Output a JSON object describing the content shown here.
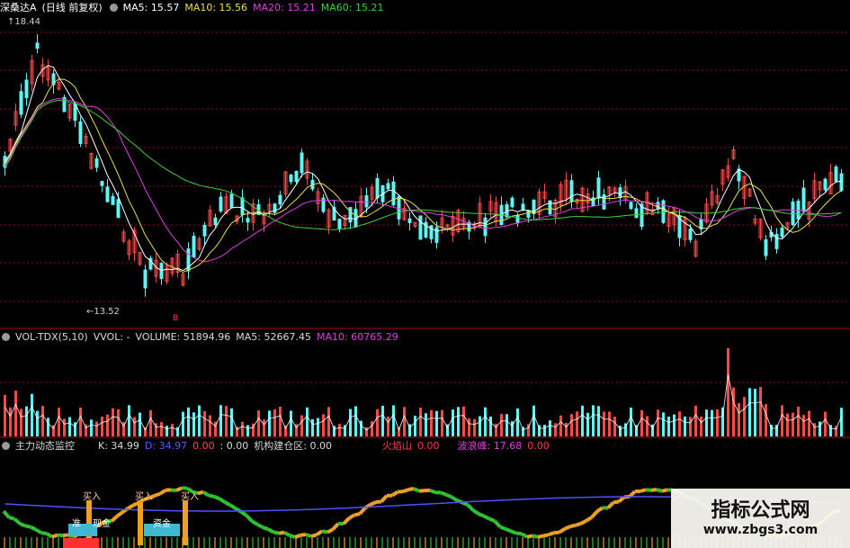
{
  "price_pane": {
    "stock_name": "深桑达A",
    "period_label": "(日线 前复权)",
    "ma5_label": "MA5: 15.57",
    "ma10_label": "MA10: 15.56",
    "ma20_label": "MA20: 15.21",
    "ma60_label": "MA60: 15.21",
    "high_label": "18.44",
    "low_label": "13.52",
    "marker": "B"
  },
  "volume_pane": {
    "indicator": "VOL-TDX(5,10)",
    "vvol": "VVOL: -",
    "volume": "VOLUME: 51894.96",
    "ma5": "MA5: 52667.45",
    "ma10": "MA10: 60765.29"
  },
  "monitor_pane": {
    "title": "主力动态监控",
    "k": "K: 34.99",
    "d": "D: 34.97",
    "v1": "0.00",
    "v2": ": 0.00",
    "build": "机构建仓区: 0.00",
    "huoyan": "火焰山",
    "huoyan_val": "0.00",
    "bowang": "波浪峰: 17.68",
    "bowang_val": "0.00",
    "buy_labels": [
      "买入",
      "买入",
      "买入"
    ],
    "labels_small": [
      "准",
      "现金",
      "资金"
    ]
  },
  "watermark": {
    "title": "指标公式网",
    "url": "www.zbgs3.com"
  },
  "colors": {
    "up": "#ff4a4a",
    "down": "#5ff5f5",
    "ma5": "#ffffff",
    "ma10": "#e8e050",
    "ma20": "#e040e0",
    "ma60": "#40d040",
    "grid": "#8a1010",
    "kline": "#5050ff",
    "wave_up": "#f0a020",
    "wave_down": "#30c030"
  }
}
